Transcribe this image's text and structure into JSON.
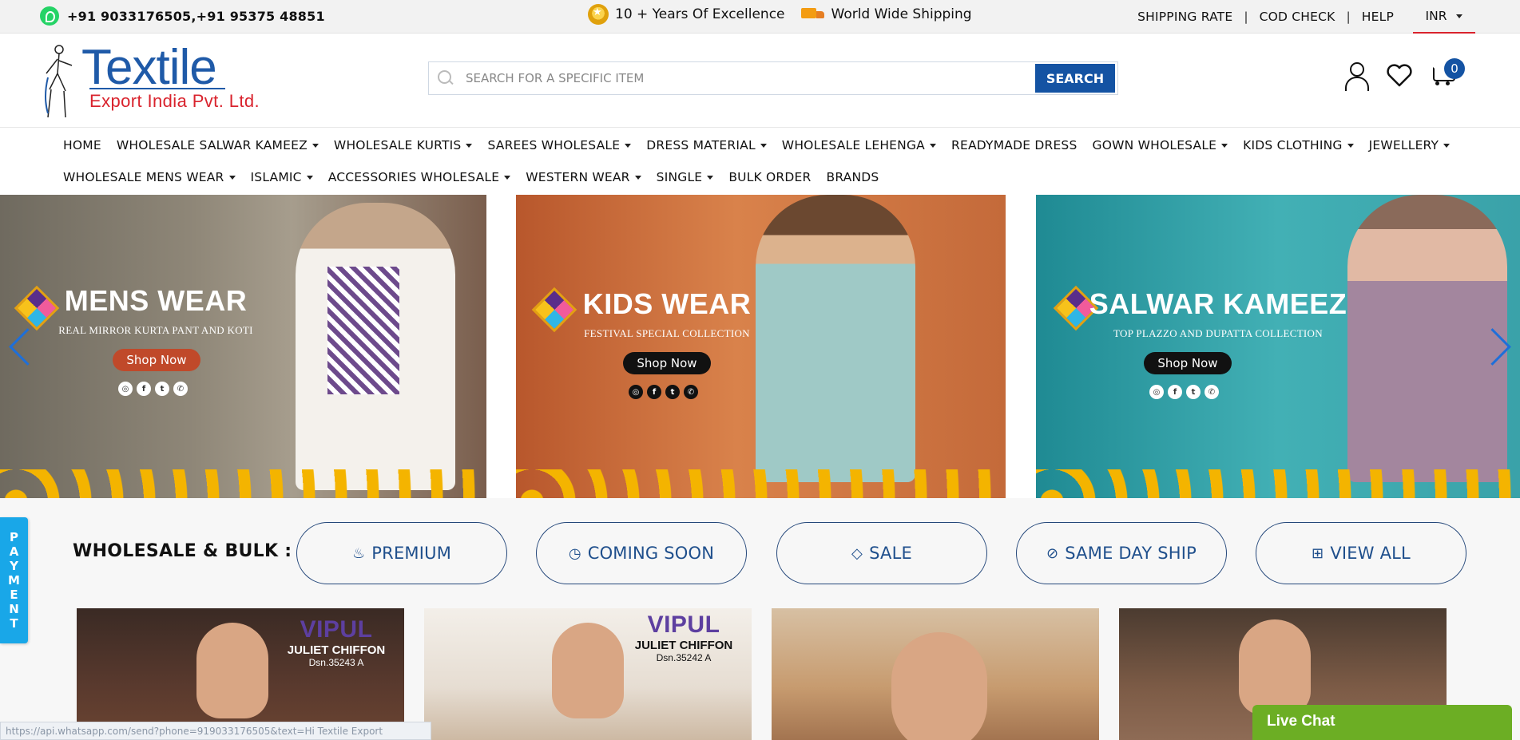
{
  "topbar": {
    "phone": "+91 9033176505,+91 95375 48851",
    "excellence": "10 + Years Of Excellence",
    "shipping": "World Wide Shipping",
    "links": [
      "SHIPPING RATE",
      "COD CHECK",
      "HELP"
    ],
    "currency": "INR",
    "icons": [
      "whatsapp-icon",
      "medal-icon",
      "truck-icon"
    ]
  },
  "header": {
    "logo_main": "Textile",
    "logo_sub": "Export India Pvt. Ltd.",
    "search_placeholder": "SEARCH FOR A SPECIFIC ITEM",
    "search_button": "SEARCH",
    "cart_count": "0",
    "icons": [
      "user-icon",
      "heart-icon",
      "cart-icon"
    ]
  },
  "nav": {
    "row1": [
      {
        "label": "HOME",
        "dropdown": false
      },
      {
        "label": "WHOLESALE SALWAR KAMEEZ",
        "dropdown": true
      },
      {
        "label": "WHOLESALE KURTIS",
        "dropdown": true
      },
      {
        "label": "SAREES WHOLESALE",
        "dropdown": true
      },
      {
        "label": "DRESS MATERIAL",
        "dropdown": true
      },
      {
        "label": "WHOLESALE LEHENGA",
        "dropdown": true
      },
      {
        "label": "READYMADE DRESS",
        "dropdown": false
      },
      {
        "label": "GOWN WHOLESALE",
        "dropdown": true
      },
      {
        "label": "KIDS CLOTHING",
        "dropdown": true
      },
      {
        "label": "JEWELLERY",
        "dropdown": true
      }
    ],
    "row2": [
      {
        "label": "WHOLESALE MENS WEAR",
        "dropdown": true
      },
      {
        "label": "ISLAMIC",
        "dropdown": true
      },
      {
        "label": "ACCESSORIES WHOLESALE",
        "dropdown": true
      },
      {
        "label": "WESTERN WEAR",
        "dropdown": true
      },
      {
        "label": "SINGLE",
        "dropdown": true
      },
      {
        "label": "BULK ORDER",
        "dropdown": false
      },
      {
        "label": "BRANDS",
        "dropdown": false
      }
    ]
  },
  "banners": [
    {
      "title": "MENS WEAR",
      "subtitle": "REAL MIRROR KURTA PANT AND KOTI",
      "button": "Shop Now",
      "button_color": "#c0492a"
    },
    {
      "title": "KIDS WEAR",
      "subtitle": "FESTIVAL SPECIAL COLLECTION",
      "button": "Shop Now",
      "button_color": "#111111"
    },
    {
      "title": "SALWAR KAMEEZ",
      "subtitle": "TOP PLAZZO AND DUPATTA COLLECTION",
      "button": "Shop Now",
      "button_color": "#111111"
    }
  ],
  "filters": {
    "label": "WHOLESALE & BULK :",
    "pills": [
      {
        "label": "PREMIUM",
        "icon": "flame-icon"
      },
      {
        "label": "COMING SOON",
        "icon": "clock-icon"
      },
      {
        "label": "SALE",
        "icon": "tag-icon"
      },
      {
        "label": "SAME DAY SHIP",
        "icon": "ban-icon"
      },
      {
        "label": "VIEW ALL",
        "icon": "grid-icon"
      }
    ]
  },
  "payment_tab": [
    "P",
    "A",
    "Y",
    "M",
    "E",
    "N",
    "T"
  ],
  "products": [
    {
      "brand": "VIPUL",
      "name": "JULIET CHIFFON",
      "dsn": "Dsn.35243 A"
    },
    {
      "brand": "VIPUL",
      "name": "JULIET CHIFFON",
      "dsn": "Dsn.35242 A"
    },
    {
      "brand": "",
      "name": "",
      "dsn": ""
    },
    {
      "brand": "",
      "name": "",
      "dsn": ""
    }
  ],
  "status_url": "https://api.whatsapp.com/send?phone=919033176505&text=Hi Textile Export",
  "live_chat": "Live Chat",
  "colors": {
    "brand_blue": "#1453a3",
    "brand_red": "#d9232d",
    "live_chat_green": "#6cae24",
    "payment_tab": "#19a7e8"
  }
}
